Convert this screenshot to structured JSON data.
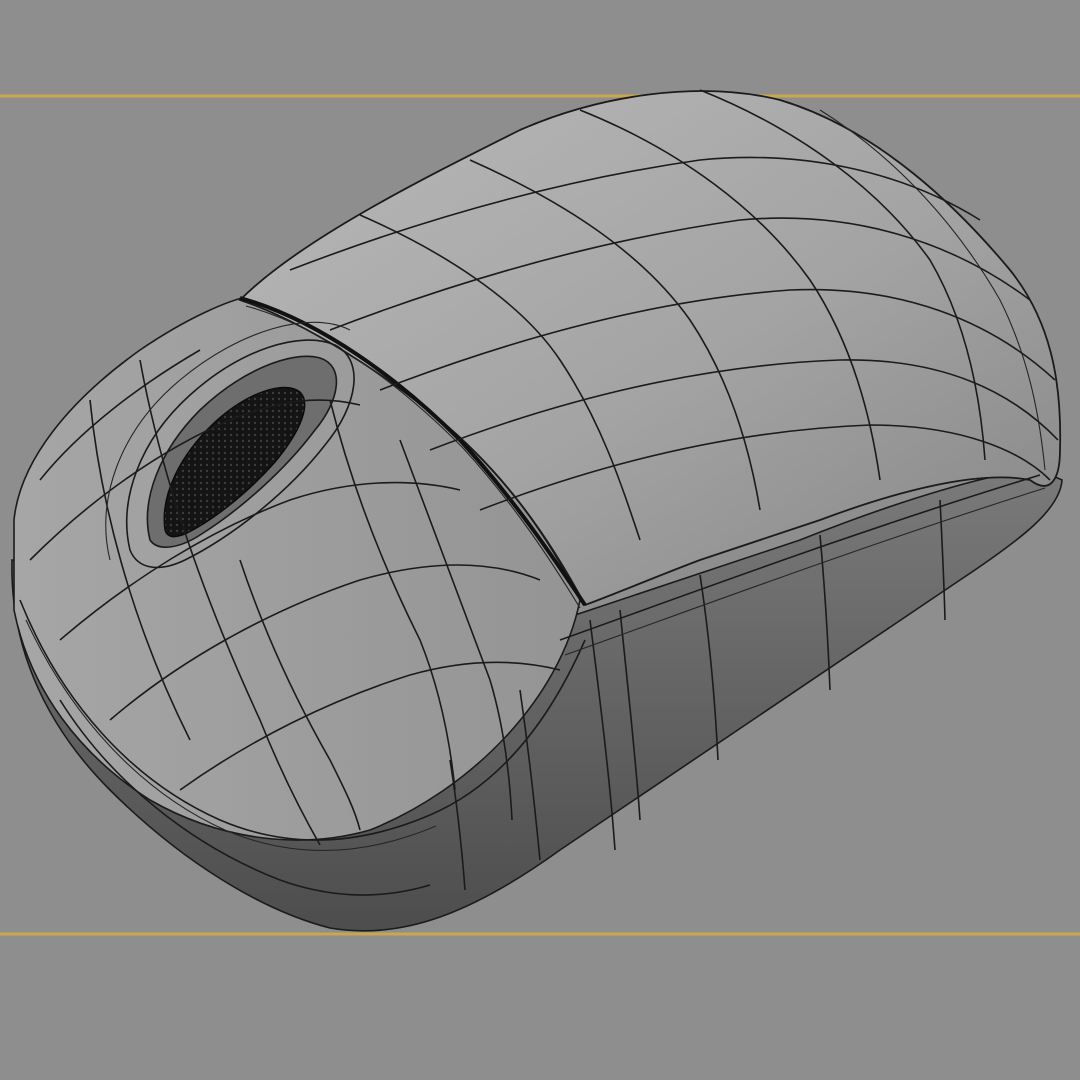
{
  "viewport": {
    "background_color": "#8e8e8e",
    "guide_line_color": "#c9a74a",
    "model": "computer-mouse-wireframe",
    "shading": "smooth-with-edged-faces"
  }
}
